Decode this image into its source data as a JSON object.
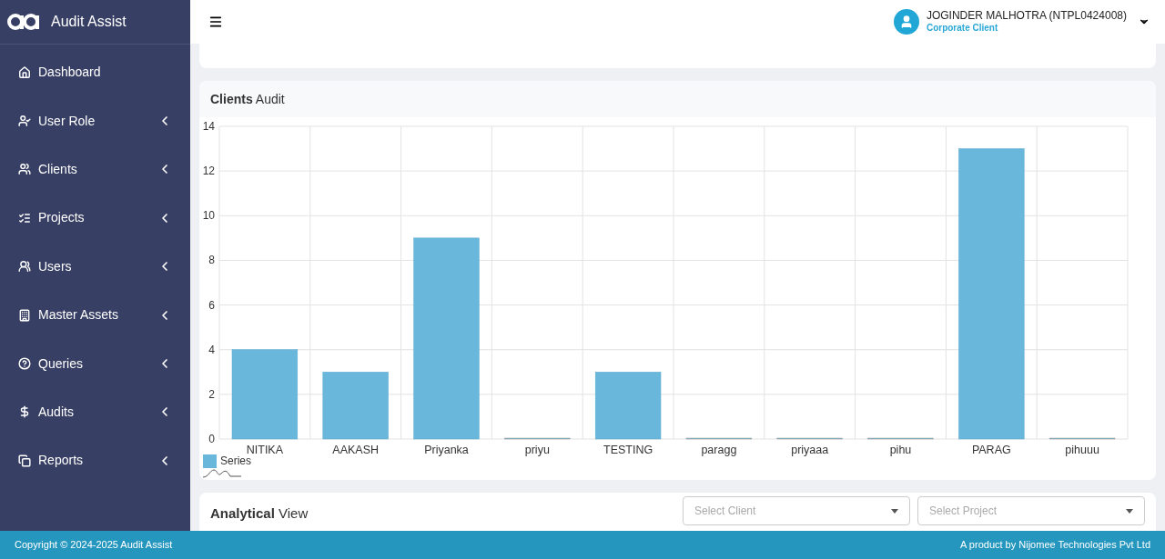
{
  "brand": {
    "name": "Audit Assist"
  },
  "sidebar": {
    "items": [
      {
        "label": "Dashboard",
        "kind": "link"
      },
      {
        "label": "User Role",
        "kind": "menu"
      },
      {
        "label": "Clients",
        "kind": "menu"
      },
      {
        "label": "Projects",
        "kind": "menu"
      },
      {
        "label": "Users",
        "kind": "menu"
      },
      {
        "label": "Master Assets",
        "kind": "menu"
      },
      {
        "label": "Queries",
        "kind": "menu"
      },
      {
        "label": "Audits",
        "kind": "menu"
      },
      {
        "label": "Reports",
        "kind": "menu"
      }
    ]
  },
  "user": {
    "name": "JOGINDER MALHOTRA (NTPL0424008)",
    "role": "Corporate Client"
  },
  "chart_card": {
    "title": "**Clients** Audit",
    "chart_data": {
      "type": "bar",
      "categories": [
        "NITIKA",
        "AAKASH",
        "Priyanka",
        "priyu",
        "TESTING",
        "paragg",
        "priyaaa",
        "pihu",
        "PARAG",
        "pihuuu"
      ],
      "series": [
        {
          "name": "Series",
          "color": "#6ab7dc",
          "values": [
            4,
            3,
            9,
            0,
            3,
            0,
            0,
            0,
            13,
            0
          ]
        }
      ],
      "ylim": [
        0,
        14
      ],
      "grid": true,
      "yticks": [
        0,
        2,
        4,
        6,
        8,
        10,
        12,
        14
      ]
    }
  },
  "analytical_card": {
    "title": "**Analytical** View",
    "client_select": {
      "placeholder": "Select Client"
    },
    "project_select": {
      "placeholder": "Select Project"
    }
  },
  "footer": {
    "copyright": "Copyright © 2024-2025 Audit Assist",
    "credit": "A product by Nijomee Technologies Pvt Ltd"
  }
}
